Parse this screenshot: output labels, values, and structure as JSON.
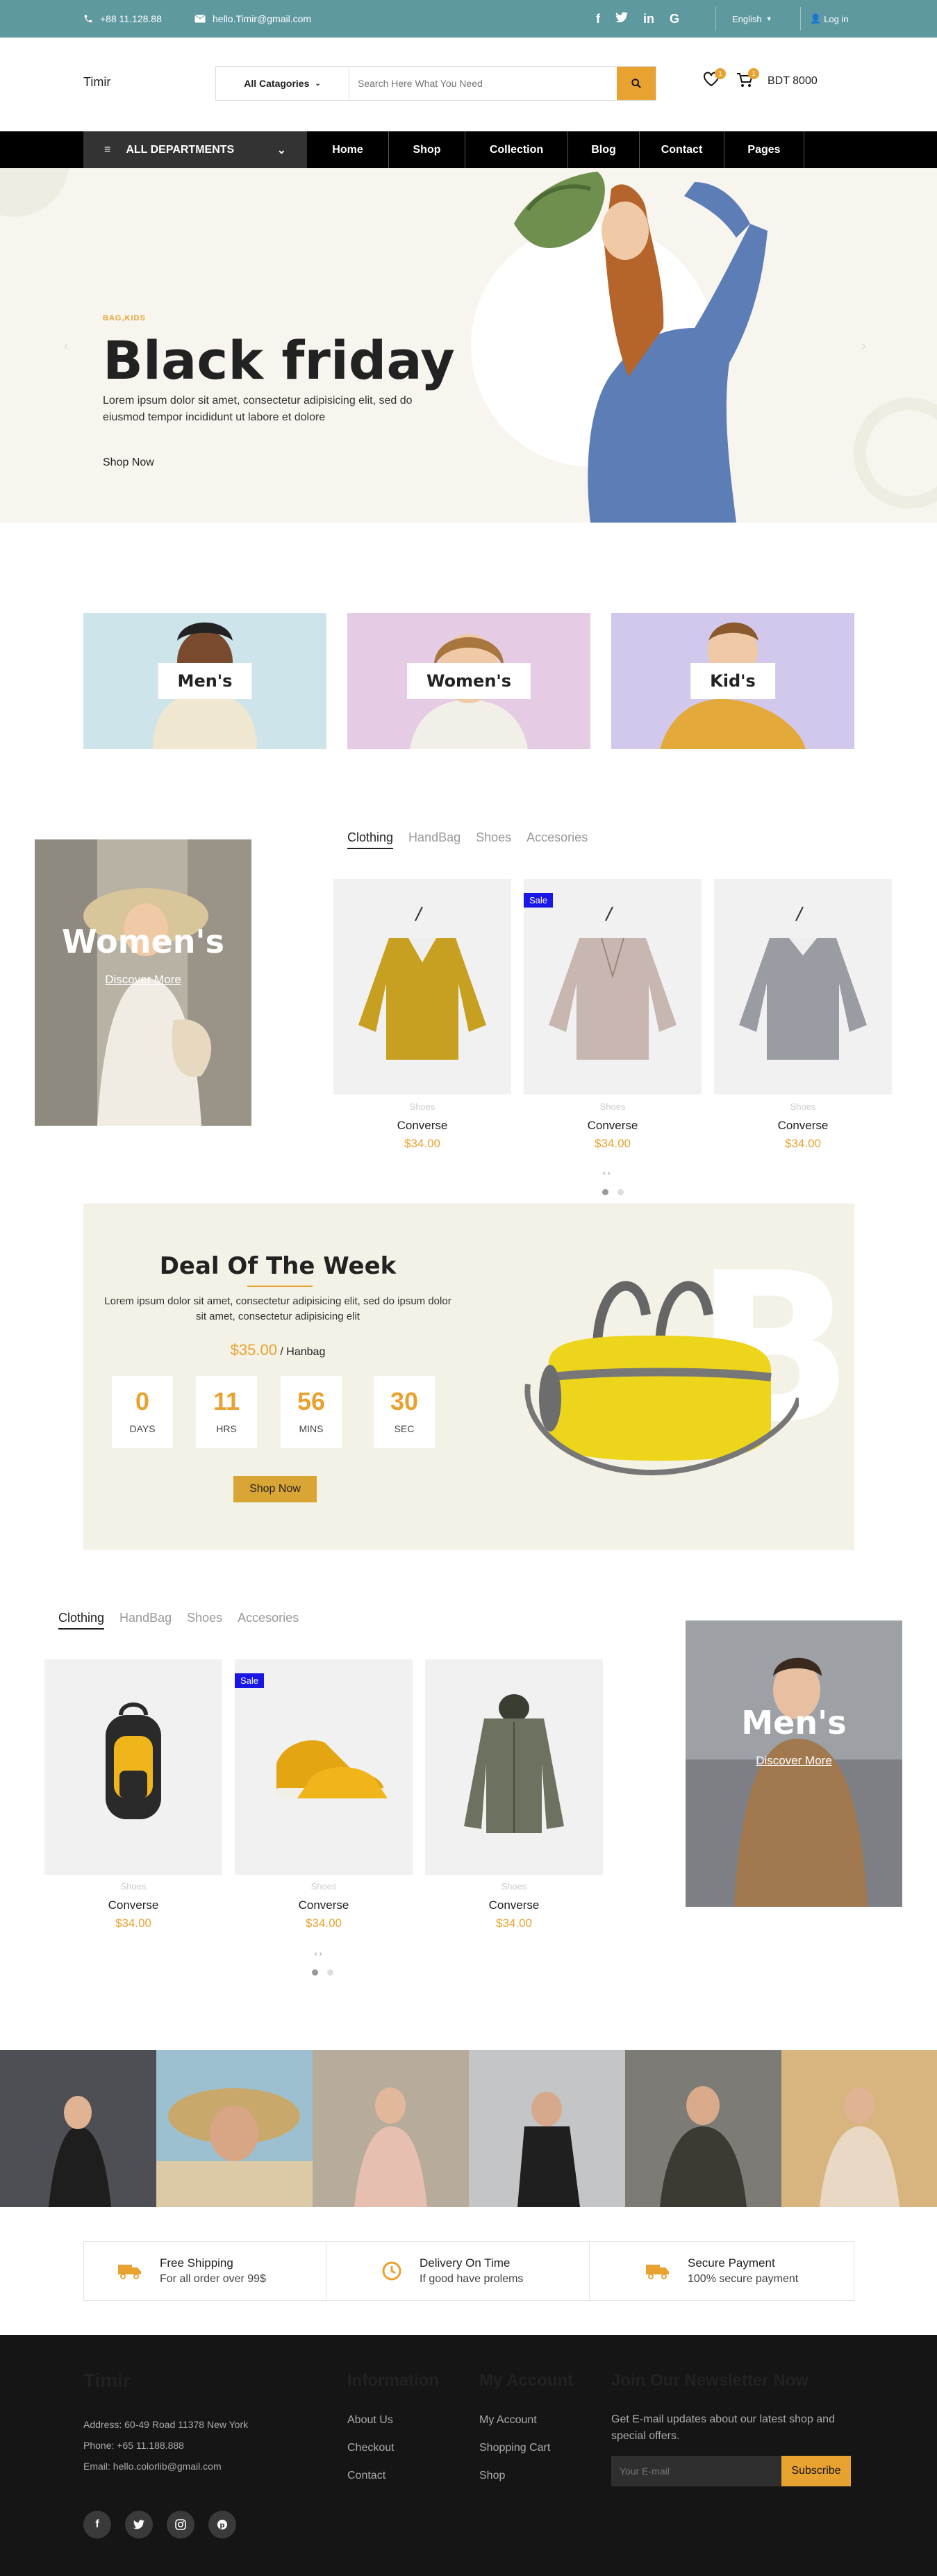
{
  "topbar": {
    "phone": "+88 11.128.88",
    "email": "hello.Timir@gmail.com",
    "language": "English",
    "login": "Log in",
    "social_icons": [
      "facebook-icon",
      "twitter-icon",
      "linkedin-icon",
      "google-icon"
    ]
  },
  "header": {
    "logo": "Timir",
    "category_select": "All Catagories",
    "search_placeholder": "Search Here What You Need",
    "wishlist_count": "1",
    "cart_count": "1",
    "cart_total": "BDT 8000"
  },
  "nav": {
    "departments": "ALL DEPARTMENTS",
    "links": [
      "Home",
      "Shop",
      "Collection",
      "Blog",
      "Contact",
      "Pages"
    ]
  },
  "hero": {
    "tag": "BAG,KIDS",
    "title": "Black friday",
    "text": "Lorem ipsum dolor sit amet, consectetur adipisicing elit, sed do eiusmod tempor incididunt ut labore et dolore",
    "cta": "Shop Now"
  },
  "categories": [
    "Men's",
    "Women's",
    "Kid's"
  ],
  "women_section": {
    "banner_title": "Women's",
    "banner_link": "Discover More",
    "tabs": [
      "Clothing",
      "HandBag",
      "Shoes",
      "Accesories"
    ],
    "sale_label": "Sale",
    "products": [
      {
        "category": "Shoes",
        "name": "Converse",
        "price": "$34.00"
      },
      {
        "category": "Shoes",
        "name": "Converse",
        "price": "$34.00"
      },
      {
        "category": "Shoes",
        "name": "Converse",
        "price": "$34.00"
      }
    ],
    "arrows": "‹ ›"
  },
  "deal": {
    "title": "Deal Of The Week",
    "text": "Lorem ipsum dolor sit amet, consectetur adipisicing elit, sed do ipsum dolor sit amet, consectetur adipisicing elit",
    "price": "$35.00",
    "category": "/ Hanbag",
    "timer": [
      {
        "value": "0",
        "label": "DAYS"
      },
      {
        "value": "11",
        "label": "HRS"
      },
      {
        "value": "56",
        "label": "MINS"
      },
      {
        "value": "30",
        "label": "SEC"
      }
    ],
    "cta": "Shop Now",
    "bg_letter": "B"
  },
  "men_section": {
    "banner_title": "Men's",
    "banner_link": "Discover More",
    "tabs": [
      "Clothing",
      "HandBag",
      "Shoes",
      "Accesories"
    ],
    "sale_label": "Sale",
    "products": [
      {
        "category": "Shoes",
        "name": "Converse",
        "price": "$34.00"
      },
      {
        "category": "Shoes",
        "name": "Converse",
        "price": "$34.00"
      },
      {
        "category": "Shoes",
        "name": "Converse",
        "price": "$34.00"
      }
    ],
    "arrows": "‹ ›"
  },
  "features": [
    {
      "title": "Free Shipping",
      "text": "For all order over 99$",
      "icon": "truck-icon"
    },
    {
      "title": "Delivery On Time",
      "text": "If good have prolems",
      "icon": "clock-icon"
    },
    {
      "title": "Secure Payment",
      "text": "100% secure payment",
      "icon": "truck-icon"
    }
  ],
  "footer": {
    "logo": "Timir",
    "address": "Address: 60-49 Road 11378 New York",
    "phone": "Phone: +65 11.188.888",
    "email": "Email: hello.colorlib@gmail.com",
    "info_title": "Information",
    "info_links": [
      "About Us",
      "Checkout",
      "Contact"
    ],
    "account_title": "My Account",
    "account_links": [
      "My Account",
      "Shopping Cart",
      "Shop"
    ],
    "newsletter_title": "Join Our Newsletter Now",
    "newsletter_text": "Get E-mail updates about our latest shop and special offers.",
    "newsletter_placeholder": "Your E-mail",
    "subscribe": "Subscribe",
    "social_icons": [
      "facebook-icon",
      "twitter-icon",
      "instagram-icon",
      "pinterest-icon"
    ]
  },
  "colors": {
    "accent": "#e8a230",
    "topbar": "#5e99a0",
    "sale": "#1a16e6"
  }
}
